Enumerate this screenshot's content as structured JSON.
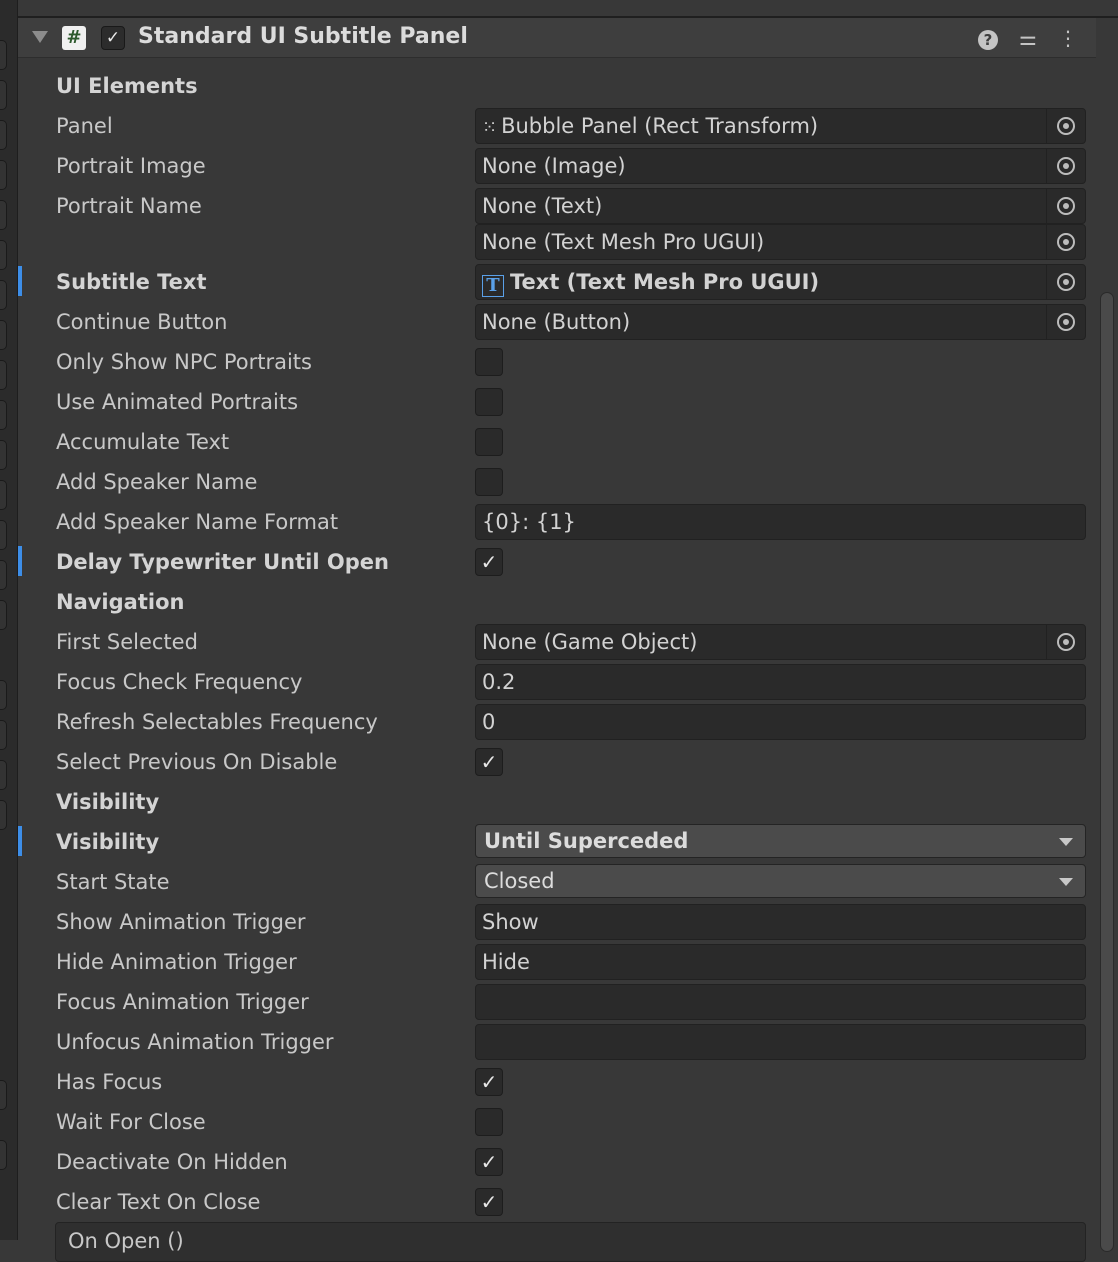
{
  "component": {
    "title": "Standard UI Subtitle Panel",
    "script_icon": "#",
    "enabled_check": "✓"
  },
  "check_glyph": "✓",
  "sections": {
    "ui_elements": "UI Elements",
    "navigation": "Navigation",
    "visibility": "Visibility"
  },
  "fields": {
    "panel": {
      "label": "Panel",
      "value": "Bubble Panel (Rect Transform)"
    },
    "portrait_image": {
      "label": "Portrait Image",
      "value": "None (Image)"
    },
    "portrait_name": {
      "label": "Portrait Name",
      "value": "None (Text)",
      "value2": "None (Text Mesh Pro UGUI)"
    },
    "subtitle_text": {
      "label": "Subtitle Text",
      "value": "Text (Text Mesh Pro UGUI)",
      "icon_glyph": "T"
    },
    "continue_button": {
      "label": "Continue Button",
      "value": "None (Button)"
    },
    "only_show_npc_portraits": {
      "label": "Only Show NPC Portraits",
      "checked": false
    },
    "use_animated_portraits": {
      "label": "Use Animated Portraits",
      "checked": false
    },
    "accumulate_text": {
      "label": "Accumulate Text",
      "checked": false
    },
    "add_speaker_name": {
      "label": "Add Speaker Name",
      "checked": false
    },
    "add_speaker_name_format": {
      "label": "Add Speaker Name Format",
      "value": "{0}: {1}"
    },
    "delay_typewriter_until_open": {
      "label": "Delay Typewriter Until Open",
      "checked": true
    },
    "first_selected": {
      "label": "First Selected",
      "value": "None (Game Object)"
    },
    "focus_check_frequency": {
      "label": "Focus Check Frequency",
      "value": "0.2"
    },
    "refresh_selectables_frequency": {
      "label": "Refresh Selectables Frequency",
      "value": "0"
    },
    "select_previous_on_disable": {
      "label": "Select Previous On Disable",
      "checked": true
    },
    "visibility": {
      "label": "Visibility",
      "value": "Until Superceded"
    },
    "start_state": {
      "label": "Start State",
      "value": "Closed"
    },
    "show_animation_trigger": {
      "label": "Show Animation Trigger",
      "value": "Show"
    },
    "hide_animation_trigger": {
      "label": "Hide Animation Trigger",
      "value": "Hide"
    },
    "focus_animation_trigger": {
      "label": "Focus Animation Trigger",
      "value": ""
    },
    "unfocus_animation_trigger": {
      "label": "Unfocus Animation Trigger",
      "value": ""
    },
    "has_focus": {
      "label": "Has Focus",
      "checked": true
    },
    "wait_for_close": {
      "label": "Wait For Close",
      "checked": false
    },
    "deactivate_on_hidden": {
      "label": "Deactivate On Hidden",
      "checked": true
    },
    "clear_text_on_close": {
      "label": "Clear Text On Close",
      "checked": true
    }
  },
  "events": {
    "on_open": "On Open ()"
  },
  "colors": {
    "modified_marker": "#3d8ee8",
    "background": "#383838"
  }
}
